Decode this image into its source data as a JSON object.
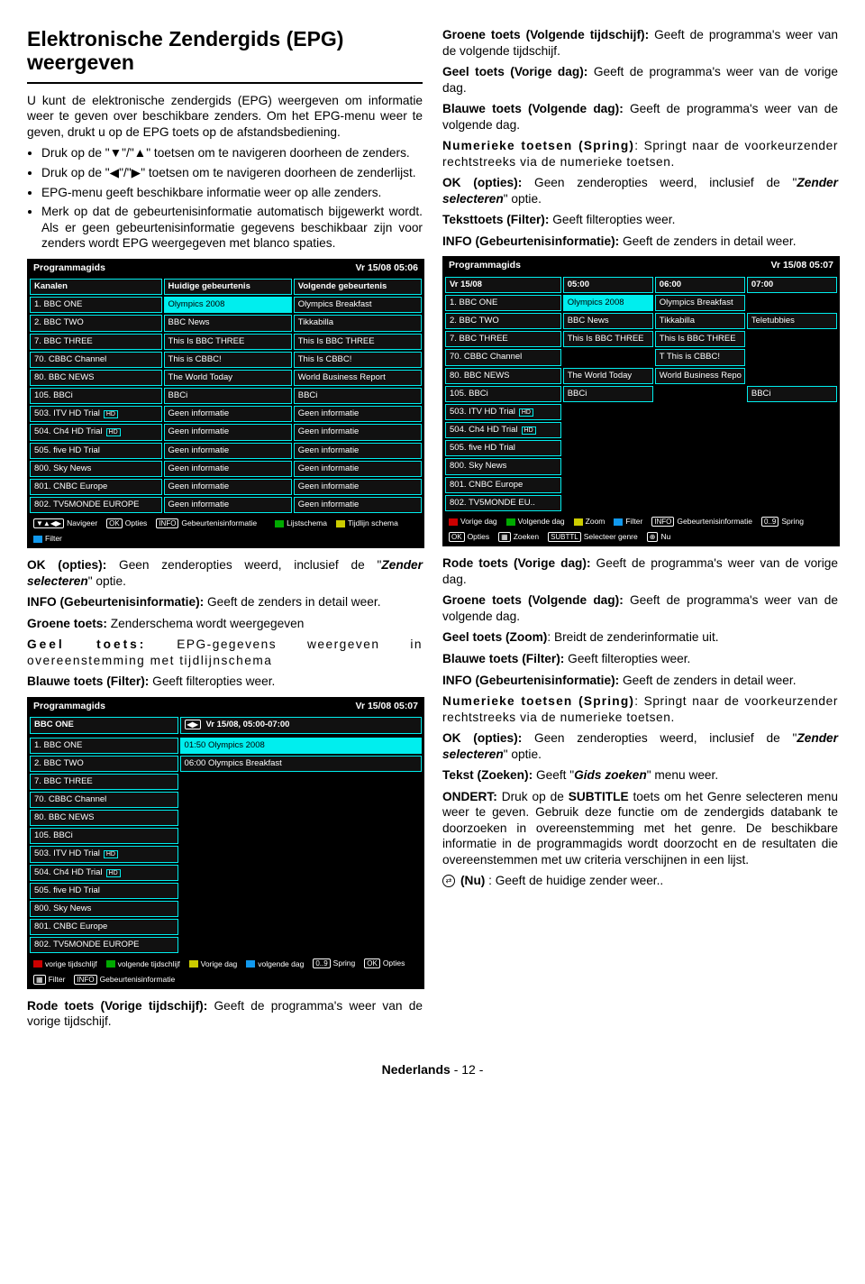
{
  "title": "Elektronische Zendergids (EPG) weergeven",
  "intro": "U kunt de elektronische zendergids (EPG) weergeven om informatie weer te geven over beschikbare zenders. Om het EPG-menu weer te geven, drukt u op de EPG toets op de afstandsbediening.",
  "b1": "Druk op de \"▼\"/\"▲\" toetsen om te navigeren doorheen de zenders.",
  "b2": "Druk op de \"◀\"/\"▶\" toetsen om te navigeren doorheen de zenderlijst.",
  "b3": "EPG-menu geeft beschikbare informatie weer op alle zenders.",
  "b4": "Merk op dat de gebeurtenisinformatie automatisch bijgewerkt wordt. Als er geen gebeurtenisinformatie gegevens beschikbaar zijn voor zenders wordt EPG weergegeven met blanco spaties.",
  "epg1": {
    "title": "Programmagids",
    "time": "Vr 15/08 05:06",
    "h1": "Kanalen",
    "h2": "Huidige gebeurtenis",
    "h3": "Volgende gebeurtenis",
    "rows": [
      [
        "1. BBC ONE",
        "Olympics 2008",
        "Olympics Breakfast"
      ],
      [
        "2. BBC TWO",
        "BBC News",
        "Tikkabilla"
      ],
      [
        "7. BBC THREE",
        "This Is BBC THREE",
        "This Is BBC THREE"
      ],
      [
        "70. CBBC Channel",
        "This is CBBC!",
        "This Is CBBC!"
      ],
      [
        "80. BBC NEWS",
        "The World Today",
        "World Business Report"
      ],
      [
        "105. BBCi",
        "BBCi",
        "BBCi"
      ],
      [
        "503. ITV HD Trial",
        "Geen informatie",
        "Geen informatie"
      ],
      [
        "504. Ch4 HD Trial",
        "Geen informatie",
        "Geen informatie"
      ],
      [
        "505. five HD Trial",
        "Geen informatie",
        "Geen informatie"
      ],
      [
        "800. Sky News",
        "Geen informatie",
        "Geen informatie"
      ],
      [
        "801. CNBC Europe",
        "Geen informatie",
        "Geen informatie"
      ],
      [
        "802. TV5MONDE EUROPE",
        "Geen informatie",
        "Geen informatie"
      ]
    ],
    "lg": {
      "nav": "Navigeer",
      "list": "Lijstschema",
      "ok": "Opties",
      "tijd": "Tijdlijn schema",
      "info": "Gebeurtenisinformatie",
      "filter": "Filter"
    }
  },
  "l1a": "OK (opties):",
  "l1b": " Geen zenderopties weerd, inclusief de \"",
  "l1c": "Zender selecteren",
  "l1d": "\" optie.",
  "l2a": "INFO (Gebeurtenisinformatie):",
  "l2b": " Geeft de zenders in detail weer.",
  "l3a": "Groene toets:",
  "l3b": " Zenderschema wordt weergegeven",
  "l4a": "Geel toets:",
  "l4b": " EPG-gegevens weergeven in overeenstemming met tijdlijnschema",
  "l5a": "Blauwe toets (Filter):",
  "l5b": " Geeft filteropties weer.",
  "epg2": {
    "title": "Programmagids",
    "time": "Vr 15/08 05:07",
    "sub": "BBC ONE",
    "sub2": "Vr 15/08, 05:00-07:00",
    "rows": [
      [
        "1. BBC ONE",
        "01:50 Olympics 2008"
      ],
      [
        "2. BBC TWO",
        "06:00 Olympics Breakfast"
      ],
      [
        "7. BBC THREE",
        ""
      ],
      [
        "70. CBBC Channel",
        ""
      ],
      [
        "80. BBC NEWS",
        ""
      ],
      [
        "105. BBCi",
        ""
      ],
      [
        "503. ITV HD Trial",
        ""
      ],
      [
        "504. Ch4 HD Trial",
        ""
      ],
      [
        "505. five HD Trial",
        ""
      ],
      [
        "800. Sky News",
        ""
      ],
      [
        "801. CNBC Europe",
        ""
      ],
      [
        "802. TV5MONDE EUROPE",
        ""
      ]
    ],
    "lg": {
      "a": "vorige tijdschlijf",
      "b": "volgende tijdschlijf",
      "c": "Vorige dag",
      "d": "volgende dag",
      "s": "Spring",
      "ok": "Opties",
      "f": "Filter",
      "info": "Gebeurtenisinformatie"
    }
  },
  "l6a": "Rode toets (Vorige tijdschijf):",
  "l6b": " Geeft de programma's weer van de vorige tijdschijf.",
  "r1a": "Groene toets (Volgende tijdschijf):",
  "r1b": " Geeft de programma's weer van de volgende tijdschijf.",
  "r2a": "Geel toets (Vorige dag):",
  "r2b": " Geeft de programma's weer van de vorige dag.",
  "r3a": "Blauwe toets (Volgende dag):",
  "r3b": " Geeft de programma's weer van de volgende dag.",
  "r4a": "Numerieke toetsen (Spring)",
  "r4b": ": Springt naar de voorkeurzender rechtstreeks via de numerieke toetsen.",
  "r5a": "OK (opties):",
  "r5b": " Geen zenderopties weerd, inclusief de \"",
  "r5c": "Zender selecteren",
  "r5d": "\" optie.",
  "r6a": "Teksttoets (Filter):",
  "r6b": " Geeft filteropties weer.",
  "r7a": "INFO (Gebeurtenisinformatie):",
  "r7b": " Geeft de zenders in detail weer.",
  "epg3": {
    "title": "Programmagids",
    "time": "Vr 15/08 05:07",
    "h": [
      "Vr 15/08",
      "05:00",
      "06:00",
      "07:00"
    ],
    "rows": [
      [
        "1. BBC ONE",
        "Olympics 2008",
        "Olympics Breakfast",
        ""
      ],
      [
        "2. BBC TWO",
        "BBC News",
        "Tikkabilla",
        "Teletubbies"
      ],
      [
        "7. BBC THREE",
        "This Is BBC THREE",
        "This Is BBC THREE",
        ""
      ],
      [
        "70. CBBC Channel",
        "",
        "T This is CBBC!",
        ""
      ],
      [
        "80. BBC NEWS",
        "The World Today",
        "World Business Repo Breakfast",
        ""
      ],
      [
        "105. BBCi",
        "BBCi",
        "",
        "BBCi"
      ],
      [
        "503. ITV HD Trial",
        "",
        "",
        ""
      ],
      [
        "504. Ch4 HD Trial",
        "",
        "",
        ""
      ],
      [
        "505. five HD Trial",
        "",
        "",
        ""
      ],
      [
        "800. Sky News",
        "",
        "",
        ""
      ],
      [
        "801. CNBC Europe",
        "",
        "",
        ""
      ],
      [
        "802. TV5MONDE EU..",
        "",
        "",
        ""
      ]
    ],
    "lg": {
      "a": "Vorige dag",
      "b": "Volgende dag",
      "c": "Zoom",
      "d": "Filter",
      "info": "Gebeurtenisinformatie",
      "s": "Spring",
      "ok": "Opties",
      "z": "Zoeken",
      "g": "Selecteer genre",
      "n": "Nu"
    }
  },
  "r8a": "Rode toets (Vorige dag):",
  "r8b": " Geeft de programma's weer van de vorige dag.",
  "r9a": "Groene toets (Volgende dag):",
  "r9b": " Geeft de programma's weer van de volgende dag.",
  "r10a": "Geel toets (Zoom)",
  "r10b": ": Breidt de zenderinformatie uit.",
  "r11a": "Blauwe toets (Filter):",
  "r11b": " Geeft filteropties weer.",
  "r12a": "INFO (Gebeurtenisinformatie):",
  "r12b": " Geeft de zenders in detail weer.",
  "r13a": "Numerieke toetsen (Spring)",
  "r13b": ": Springt naar de voorkeurzender rechtstreeks via de numerieke toetsen.",
  "r14a": "OK (opties):",
  "r14b": " Geen zenderopties weerd, inclusief de \"",
  "r14c": "Zender selecteren",
  "r14d": "\" optie.",
  "r15a": "Tekst (Zoeken):",
  "r15b": " Geeft \"",
  "r15c": "Gids zoeken",
  "r15d": "\" menu weer.",
  "r16a": "ONDERT:",
  "r16b": " Druk op de ",
  "r16c": "SUBTITLE",
  "r16d": " toets om het Genre selecteren menu weer te geven. Gebruik deze functie om de zendergids databank te doorzoeken in overeenstemming met het genre. De beschikbare informatie in de programmagids wordt doorzocht en de resultaten die overeenstemmen met uw criteria verschijnen in een lijst.",
  "r17a": " (Nu)",
  "r17b": " : Geeft de huidige zender weer..",
  "footL": "Nederlands",
  "footR": "  - 12 -"
}
